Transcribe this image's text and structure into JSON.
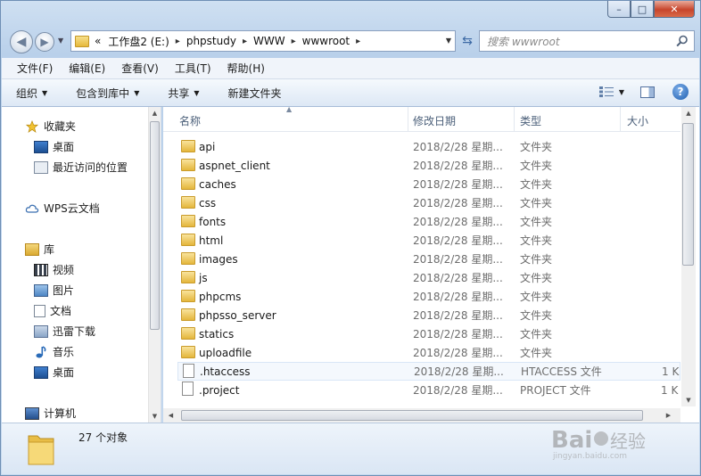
{
  "window": {
    "caption": {
      "min": "–",
      "max": "□",
      "close": "✕"
    }
  },
  "address": {
    "back_glyph": "◀",
    "fwd_glyph": "▶",
    "prefix": "«",
    "crumbs": [
      "工作盘2 (E:)",
      "phpstudy",
      "WWW",
      "wwwroot"
    ],
    "sep": "▸",
    "dropdown": "▼",
    "refresh_glyph": "⇆",
    "search_placeholder": "搜索 wwwroot"
  },
  "menu": [
    "文件(F)",
    "编辑(E)",
    "查看(V)",
    "工具(T)",
    "帮助(H)"
  ],
  "commands": {
    "organize": "组织",
    "include_library": "包含到库中",
    "share": "共享",
    "new_folder": "新建文件夹",
    "arrow": "▼",
    "help": "?"
  },
  "nav": {
    "favorites": "收藏夹",
    "desktop": "桌面",
    "recent": "最近访问的位置",
    "wps": "WPS云文档",
    "library": "库",
    "video": "视频",
    "pictures": "图片",
    "documents": "文档",
    "thunder": "迅雷下载",
    "music": "音乐",
    "desktop2": "桌面",
    "computer": "计算机"
  },
  "columns": {
    "name": "名称",
    "date": "修改日期",
    "type": "类型",
    "size": "大小"
  },
  "files": [
    {
      "name": "api",
      "date": "2018/2/28 星期...",
      "type": "文件夹",
      "size": ""
    },
    {
      "name": "aspnet_client",
      "date": "2018/2/28 星期...",
      "type": "文件夹",
      "size": ""
    },
    {
      "name": "caches",
      "date": "2018/2/28 星期...",
      "type": "文件夹",
      "size": ""
    },
    {
      "name": "css",
      "date": "2018/2/28 星期...",
      "type": "文件夹",
      "size": ""
    },
    {
      "name": "fonts",
      "date": "2018/2/28 星期...",
      "type": "文件夹",
      "size": ""
    },
    {
      "name": "html",
      "date": "2018/2/28 星期...",
      "type": "文件夹",
      "size": ""
    },
    {
      "name": "images",
      "date": "2018/2/28 星期...",
      "type": "文件夹",
      "size": ""
    },
    {
      "name": "js",
      "date": "2018/2/28 星期...",
      "type": "文件夹",
      "size": ""
    },
    {
      "name": "phpcms",
      "date": "2018/2/28 星期...",
      "type": "文件夹",
      "size": ""
    },
    {
      "name": "phpsso_server",
      "date": "2018/2/28 星期...",
      "type": "文件夹",
      "size": ""
    },
    {
      "name": "statics",
      "date": "2018/2/28 星期...",
      "type": "文件夹",
      "size": ""
    },
    {
      "name": "uploadfile",
      "date": "2018/2/28 星期...",
      "type": "文件夹",
      "size": ""
    },
    {
      "name": ".htaccess",
      "date": "2018/2/28 星期...",
      "type": "HTACCESS 文件",
      "size": "1 K"
    },
    {
      "name": ".project",
      "date": "2018/2/28 星期...",
      "type": "PROJECT 文件",
      "size": "1 K"
    }
  ],
  "status": {
    "count": "27 个对象"
  },
  "watermark": {
    "brand": "Baidu经验",
    "url": "jingyan.baidu.com"
  },
  "colors": {
    "window_chrome": "#c4d8ee",
    "folder": "#e6b93b",
    "text_muted": "#6d6d6d",
    "header_text": "#4c607a"
  }
}
